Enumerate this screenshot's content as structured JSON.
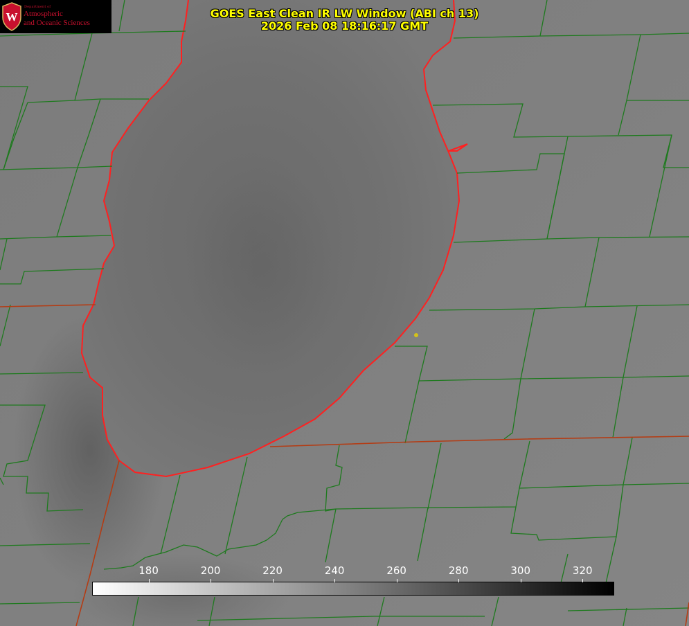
{
  "title": {
    "line1": "GOES East Clean IR LW Window (ABI ch 13)",
    "line2": "2026 Feb 08 18:16:17 GMT"
  },
  "logo": {
    "dept": "Department of",
    "line1": "Atmospheric",
    "line2": "and Oceanic Sciences",
    "crest_letter": "W",
    "color": "#c8102e"
  },
  "colorbar": {
    "ticks": [
      "180",
      "200",
      "220",
      "240",
      "260",
      "280",
      "300",
      "320"
    ],
    "min": 162,
    "max": 330,
    "start_color": "#ffffff",
    "end_color": "#000000"
  },
  "colors": {
    "title": "#ffff00",
    "lake_outline": "#ff2020",
    "county_lines": "#1e7a1e",
    "state_lines": "#b43c14",
    "marker": "#d4c21a"
  },
  "icons": {
    "station_marker": "dot-icon",
    "crest": "uw-crest-icon"
  }
}
